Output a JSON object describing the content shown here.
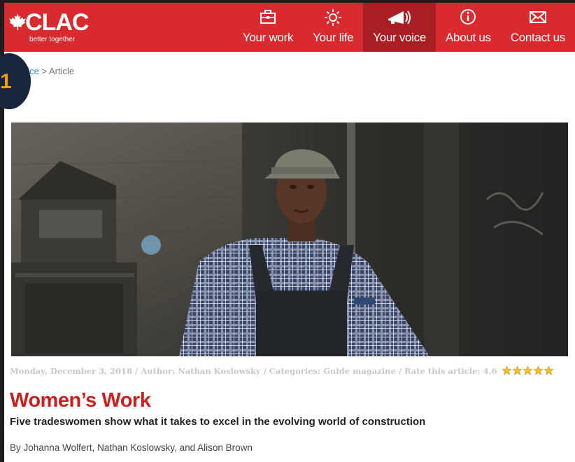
{
  "header": {
    "logo_text": "CLAC",
    "logo_tagline": "better together",
    "brand_color": "#d92b2f",
    "nav": [
      {
        "label": "Your work",
        "icon": "briefcase-icon"
      },
      {
        "label": "Your life",
        "icon": "sun-icon"
      },
      {
        "label": "Your voice",
        "icon": "megaphone-icon",
        "active": true
      },
      {
        "label": "About us",
        "icon": "info-icon"
      },
      {
        "label": "Contact us",
        "icon": "envelope-icon"
      }
    ]
  },
  "breadcrumb": {
    "link": "Voice",
    "separator": ">",
    "current": "Article"
  },
  "badge": {
    "number": "1"
  },
  "article": {
    "meta": "Monday, December 3, 2018 / Author: Nathan Koslowsky / Categories: Guide magazine / Rate this article: 4.6",
    "rating": 4.6,
    "rating_max": 5,
    "title": "Women’s Work",
    "subtitle": "Five tradeswomen show what it takes to excel in the evolving world of construction",
    "byline": "By Johanna Wolfert, Nathan Koslowsky, and Alison Brown"
  }
}
